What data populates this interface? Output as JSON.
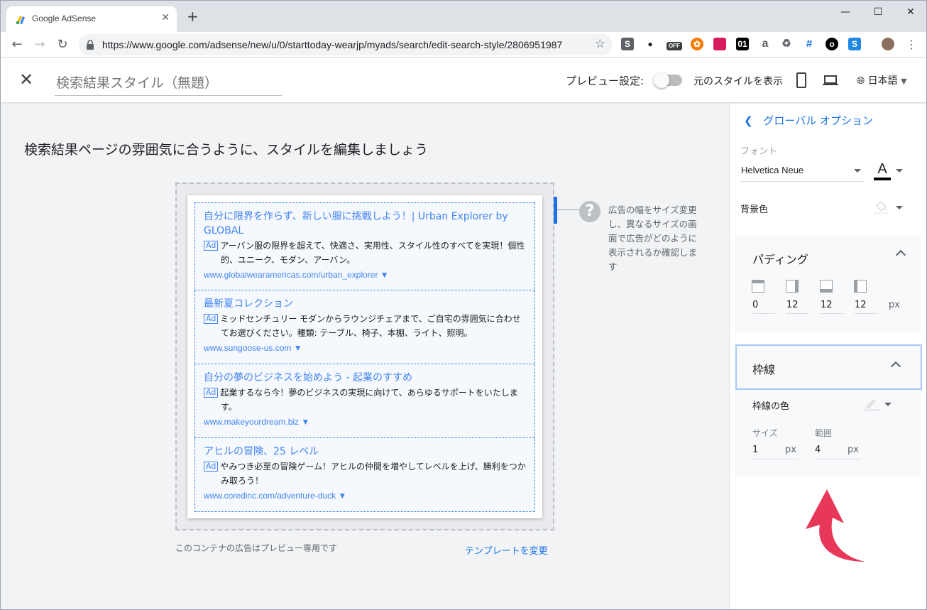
{
  "browser": {
    "tab_title": "Google AdSense",
    "url": "https://www.google.com/adsense/new/u/0/starttoday-wearjp/myads/search/edit-search-style/2806951987",
    "ext_badge_off": "OFF",
    "ext_01": "01",
    "ext_a": "a"
  },
  "header": {
    "title_placeholder": "検索結果スタイル（無題）",
    "preview_label": "プレビュー設定:",
    "original_label": "元のスタイルを表示",
    "language": "日本語"
  },
  "main": {
    "heading": "検索結果ページの雰囲気に合うように、スタイルを編集しましょう",
    "help_text": "広告の幅をサイズ変更し、異なるサイズの画面で広告がどのように表示されるか確認します",
    "footer_note": "このコンテナの広告はプレビュー専用です",
    "change_template": "テンプレートを変更",
    "ad_badge": "Ad",
    "ads": [
      {
        "title": "自分に限界を作らず、新しい服に挑戦しよう！| Urban Explorer by GLOBAL",
        "desc": "アーバン服の限界を超えて、快適さ、実用性、スタイル性のすべてを実現！個性的、ユニーク、モダン、アーバン。",
        "url": "www.globalwearamericas.com/urban_explorer ▼"
      },
      {
        "title": "最新夏コレクション",
        "desc": "ミッドセンチュリー モダンからラウンジチェアまで、ご自宅の雰囲気に合わせてお選びください。種類: テーブル、椅子、本棚、ライト、照明。",
        "url": "www.sungoose-us.com ▼"
      },
      {
        "title": "自分の夢のビジネスを始めよう - 起業のすすめ",
        "desc": "起業するなら今！夢のビジネスの実現に向けて、あらゆるサポートをいたします。",
        "url": "www.makeyourdream.biz ▼"
      },
      {
        "title": "アヒルの冒険、25 レベル",
        "desc": "やみつき必至の冒険ゲーム！アヒルの仲間を増やしてレベルを上げ、勝利をつかみ取ろう！",
        "url": "www.coredinc.com/adventure-duck ▼"
      }
    ]
  },
  "sidebar": {
    "back_label": "グローバル オプション",
    "font_label": "フォント",
    "font_value": "Helvetica Neue",
    "font_color_glyph": "A",
    "bg_color_label": "背景色",
    "padding": {
      "title": "パディング",
      "values": [
        "0",
        "12",
        "12",
        "12"
      ],
      "unit": "px"
    },
    "border": {
      "title": "枠線",
      "color_label": "枠線の色",
      "size_label": "サイズ",
      "size_value": "1",
      "size_unit": "px",
      "radius_label": "範囲",
      "radius_value": "4",
      "radius_unit": "px"
    }
  },
  "colors": {
    "accent": "#1a73e8",
    "ad_link": "#4285f4",
    "annotation_arrow": "#e8385a"
  }
}
